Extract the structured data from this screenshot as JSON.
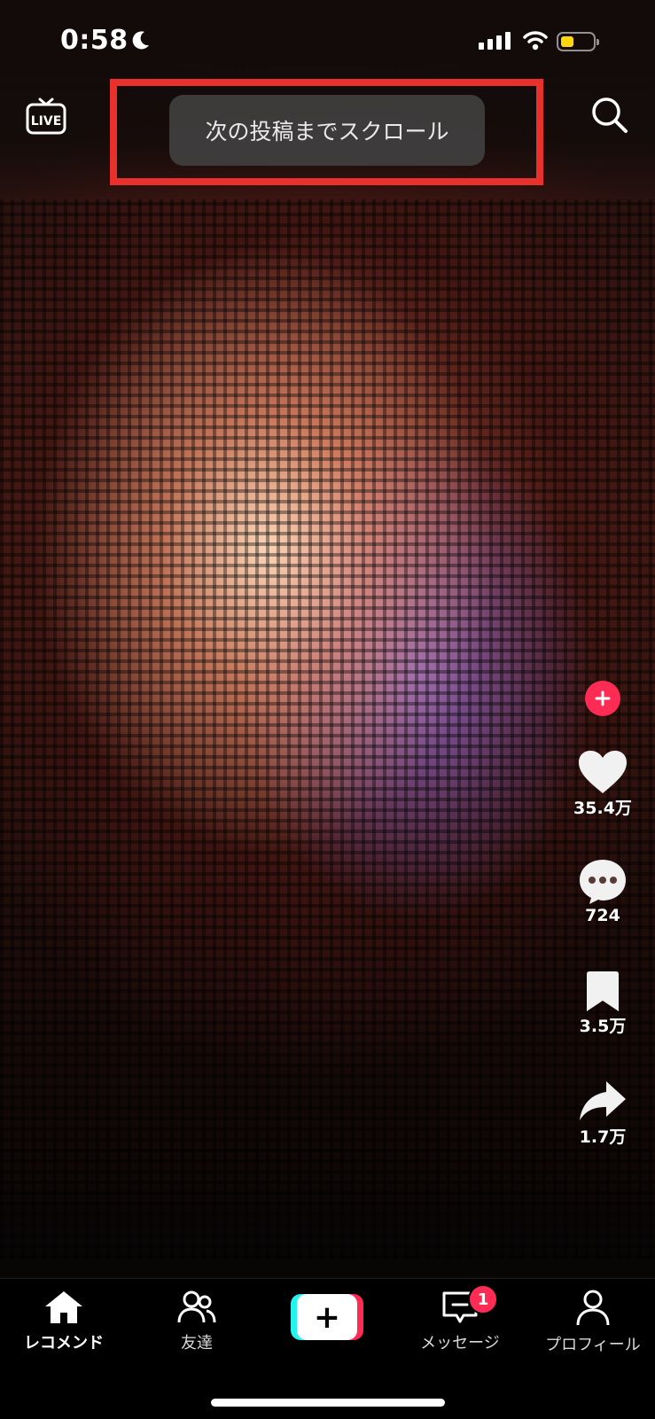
{
  "status_bar": {
    "time": "0:58",
    "battery_color": "#ffd60a"
  },
  "top_bar": {
    "live_label": "LIVE",
    "toast_text": "次の投稿までスクロール",
    "highlight_color": "#e8312c"
  },
  "rail": {
    "likes": "35.4万",
    "comments": "724",
    "saves": "3.5万",
    "shares": "1.7万",
    "accent_color": "#fe2c55"
  },
  "bottom_nav": {
    "home": "レコメンド",
    "friends": "友達",
    "messages": "メッセージ",
    "messages_badge": "1",
    "profile": "プロフィール"
  }
}
